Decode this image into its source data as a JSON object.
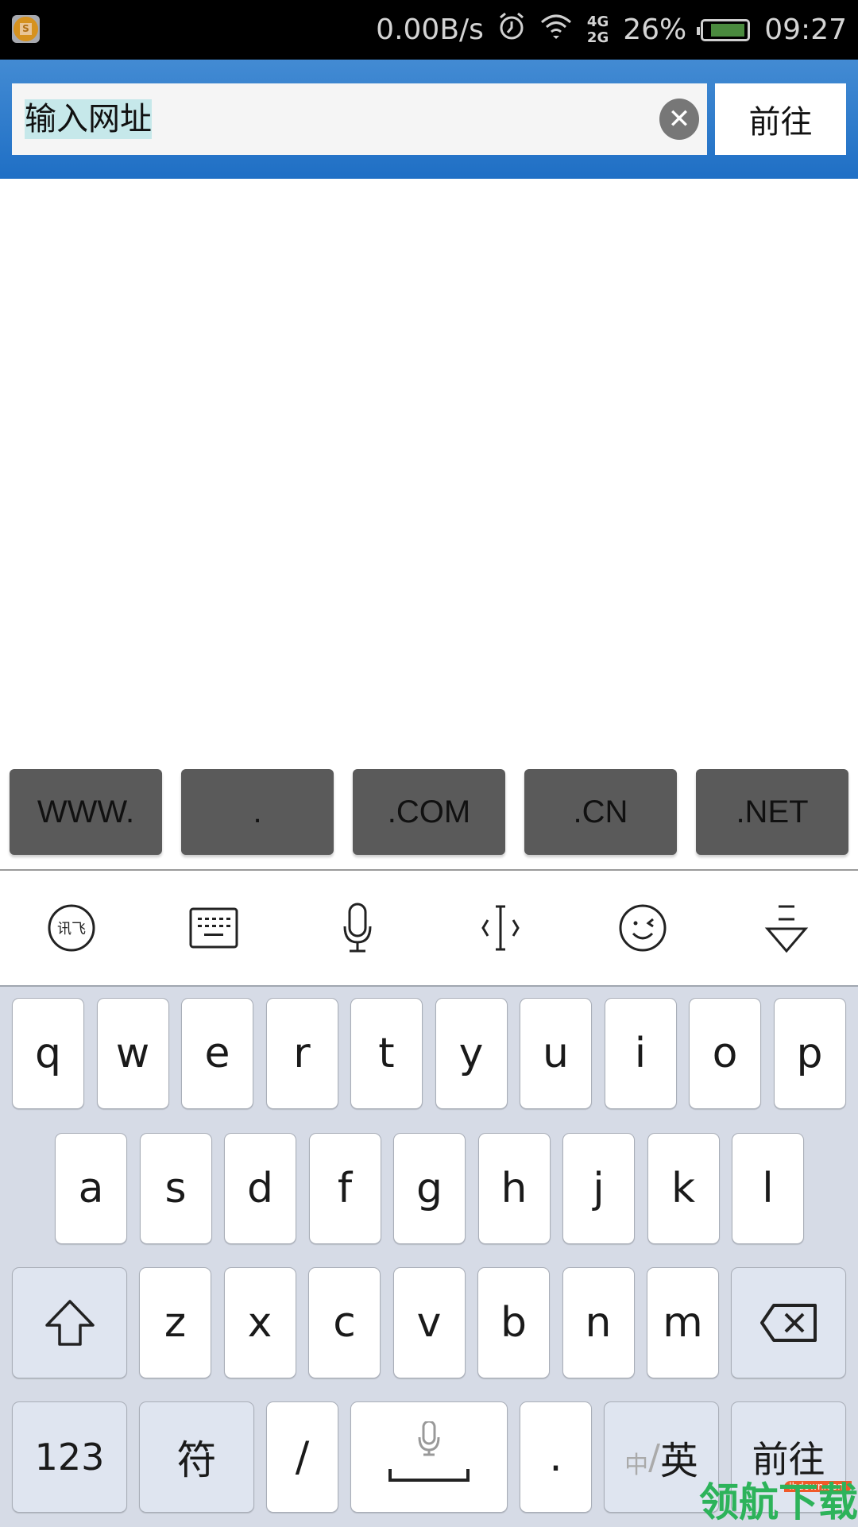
{
  "status_bar": {
    "app_icon": "app-icon",
    "net_speed": "0.00B/s",
    "alarm_icon": "alarm-icon",
    "wifi_icon": "wifi-icon",
    "network_top": "4G",
    "network_bottom": "2G",
    "battery_percent": "26%",
    "battery_level": 0.26,
    "time": "09:27"
  },
  "top_bar": {
    "url_input": {
      "value": "输入网址",
      "selected": true
    },
    "clear_icon": "clear-circle-icon",
    "go_button": "前往"
  },
  "shortcuts": [
    ".",
    "WWW.",
    ".COM",
    ".CN",
    ".NET"
  ],
  "shortcut_order": [
    "WWW.",
    ".",
    ".COM",
    ".CN",
    ".NET"
  ],
  "ime_toolbar": [
    {
      "icon": "xunfei-logo-icon",
      "label": "讯飞"
    },
    {
      "icon": "keyboard-icon"
    },
    {
      "icon": "microphone-icon"
    },
    {
      "icon": "cursor-move-icon"
    },
    {
      "icon": "emoji-icon"
    },
    {
      "icon": "hide-keyboard-icon"
    }
  ],
  "keyboard": {
    "row1": [
      "q",
      "w",
      "e",
      "r",
      "t",
      "y",
      "u",
      "i",
      "o",
      "p"
    ],
    "row2": [
      "a",
      "s",
      "d",
      "f",
      "g",
      "h",
      "j",
      "k",
      "l"
    ],
    "row3": [
      "z",
      "x",
      "c",
      "v",
      "b",
      "n",
      "m"
    ],
    "shift_icon": "shift-icon",
    "backspace_icon": "backspace-icon",
    "bottom": {
      "numbers": "123",
      "symbols": "符",
      "slash": "/",
      "space_icon": "space-mic-icon",
      "period": ".",
      "lang_inactive": "中",
      "lang_sep": "/",
      "lang_active": "英",
      "enter": "前往"
    }
  },
  "watermark": {
    "text": "领航下载",
    "badge": "lhdown.com"
  },
  "colors": {
    "accent_blue": "#2a78cc",
    "battery_green": "#4a8a3e",
    "keyboard_bg": "#d6dbe6",
    "watermark_green": "#2db35a"
  }
}
